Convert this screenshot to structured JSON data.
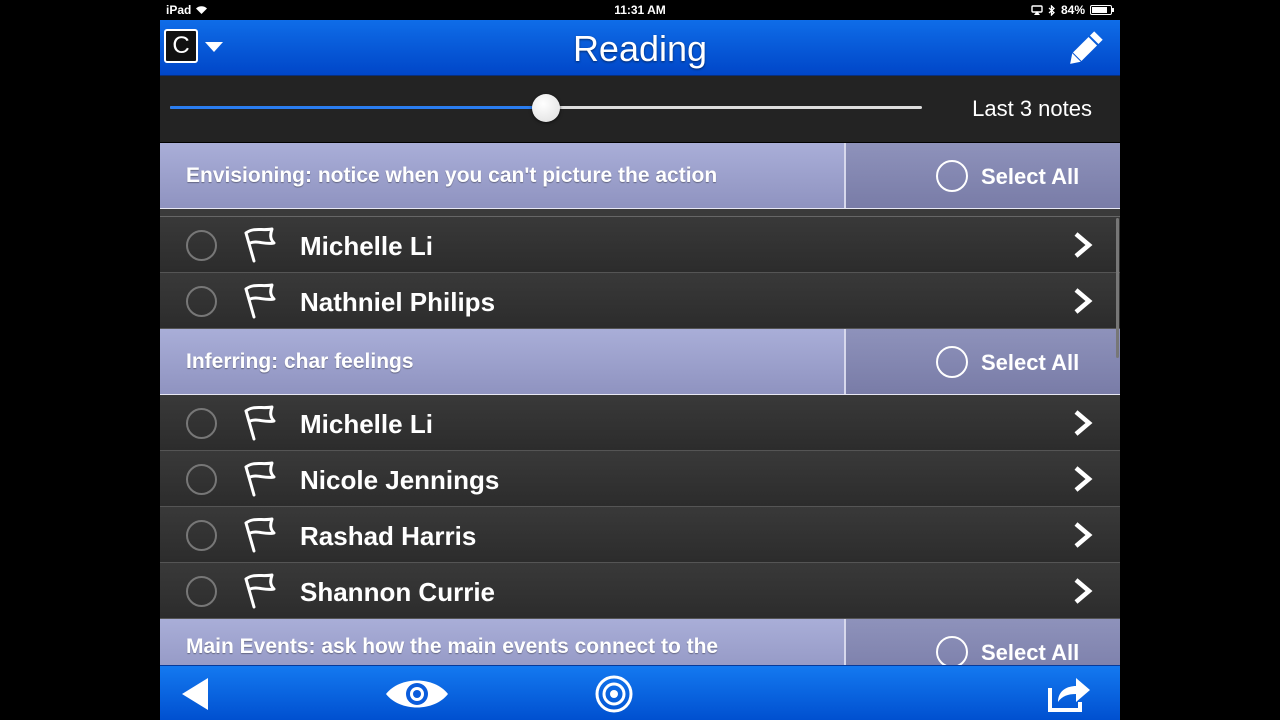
{
  "status_bar": {
    "device": "iPad",
    "time": "11:31 AM",
    "battery": "84%",
    "battery_level": 0.84
  },
  "nav": {
    "class_letter": "C",
    "title": "Reading"
  },
  "slider": {
    "value_fraction": 0.5,
    "label": "Last 3 notes"
  },
  "sections": [
    {
      "title": "Envisioning: notice when you can't picture the action",
      "select_all": "Select All",
      "students": [
        "Michelle Li",
        "Nathniel Philips"
      ]
    },
    {
      "title": "Inferring: char feelings",
      "select_all": "Select All",
      "students": [
        "Michelle Li",
        "Nicole Jennings",
        "Rashad Harris",
        "Shannon Currie"
      ]
    },
    {
      "title": "Main Events: ask how the main events connect to the",
      "select_all": "Select All",
      "students": []
    }
  ],
  "icons": {
    "class": "class-selector-icon",
    "edit": "pencil-icon",
    "flag": "flag-icon",
    "chevron": "chevron-right-icon",
    "back": "back-arrow-icon",
    "eye": "eye-icon",
    "target": "target-icon",
    "share": "share-icon"
  },
  "colors": {
    "nav_blue": "#0a5cdc",
    "section_header": "#9ca0cc",
    "row_bg": "#333333"
  }
}
